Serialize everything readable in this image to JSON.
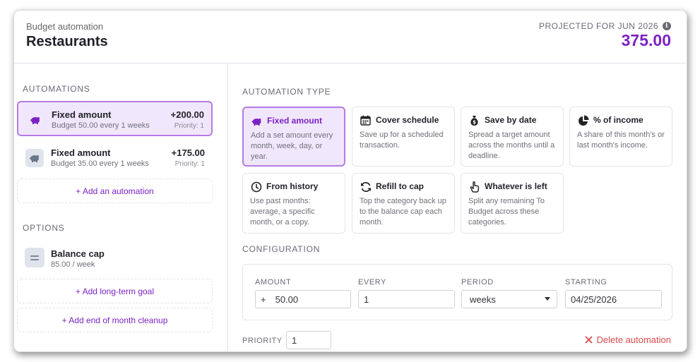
{
  "header": {
    "subtitle": "Budget automation",
    "title": "Restaurants",
    "projected_label": "PROJECTED FOR JUN 2026",
    "projected_amount": "375.00"
  },
  "sidebar": {
    "automations_label": "AUTOMATIONS",
    "automations": [
      {
        "name": "Fixed amount",
        "desc": "Budget 50.00 every 1 weeks",
        "amount": "+200.00",
        "priority": "Priority: 1",
        "icon": "piggy-bank-icon",
        "selected": true
      },
      {
        "name": "Fixed amount",
        "desc": "Budget 35.00 every 1 weeks",
        "amount": "+175.00",
        "priority": "Priority: 1",
        "icon": "piggy-bank-icon",
        "selected": false
      }
    ],
    "add_automation": "+ Add an automation",
    "options_label": "OPTIONS",
    "balance_cap": {
      "name": "Balance cap",
      "desc": "85.00 / week",
      "icon": "equals-icon"
    },
    "add_long_term_goal": "+ Add long-term goal",
    "add_cleanup": "+ Add end of month cleanup"
  },
  "main": {
    "type_label": "AUTOMATION TYPE",
    "types": [
      {
        "title": "Fixed amount",
        "desc": "Add a set amount every month, week, day, or year.",
        "icon": "piggy-bank-icon",
        "selected": true
      },
      {
        "title": "Cover schedule",
        "desc": "Save up for a scheduled transaction.",
        "icon": "calendar-icon",
        "selected": false
      },
      {
        "title": "Save by date",
        "desc": "Spread a target amount across the months until a deadline.",
        "icon": "money-bag-icon",
        "selected": false
      },
      {
        "title": "% of income",
        "desc": "A share of this month's or last month's income.",
        "icon": "pie-chart-icon",
        "selected": false
      },
      {
        "title": "From history",
        "desc": "Use past months: average, a specific month, or a copy.",
        "icon": "history-icon",
        "selected": false
      },
      {
        "title": "Refill to cap",
        "desc": "Top the category back up to the balance cap each month.",
        "icon": "refresh-icon",
        "selected": false
      },
      {
        "title": "Whatever is left",
        "desc": "Split any remaining To Budget across these categories.",
        "icon": "hand-pointer-icon",
        "selected": false
      }
    ],
    "config_label": "CONFIGURATION",
    "config": {
      "amount_label": "AMOUNT",
      "amount_prefix": "+",
      "amount_value": "50.00",
      "every_label": "EVERY",
      "every_value": "1",
      "period_label": "PERIOD",
      "period_value": "weeks",
      "starting_label": "STARTING",
      "starting_value": "04/25/2026"
    },
    "priority_label": "PRIORITY",
    "priority_value": "1",
    "delete_label": "Delete automation"
  },
  "colors": {
    "accent": "#7c22c4",
    "selected_bg": "#f1e7fc",
    "selected_border": "#b57be8",
    "danger": "#d84a4a"
  }
}
